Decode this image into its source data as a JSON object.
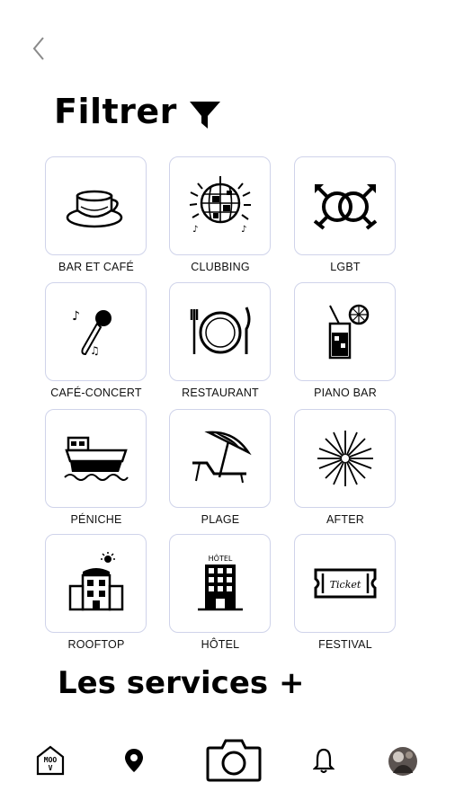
{
  "header": {
    "title": "Filtrer"
  },
  "categories": [
    {
      "label": "BAR ET CAFÉ",
      "icon": "coffee-cup-icon"
    },
    {
      "label": "CLUBBING",
      "icon": "disco-ball-icon"
    },
    {
      "label": "LGBT",
      "icon": "gender-symbols-icon"
    },
    {
      "label": "CAFÉ-CONCERT",
      "icon": "microphone-icon"
    },
    {
      "label": "RESTAURANT",
      "icon": "plate-cutlery-icon"
    },
    {
      "label": "PIANO BAR",
      "icon": "cocktail-icon"
    },
    {
      "label": "PÉNICHE",
      "icon": "barge-icon"
    },
    {
      "label": "PLAGE",
      "icon": "beach-chair-icon"
    },
    {
      "label": "AFTER",
      "icon": "fireworks-icon"
    },
    {
      "label": "ROOFTOP",
      "icon": "rooftop-building-icon"
    },
    {
      "label": "HÔTEL",
      "icon": "hotel-building-icon"
    },
    {
      "label": "FESTIVAL",
      "icon": "ticket-icon"
    }
  ],
  "hotel_sign": "HÔTEL",
  "ticket_text": "Ticket",
  "services": {
    "title": "Les services +"
  },
  "tabbar": {
    "logo_text": "MOOV",
    "items": [
      "home-logo-icon",
      "location-pin-icon",
      "camera-icon",
      "bell-icon",
      "avatar"
    ]
  }
}
